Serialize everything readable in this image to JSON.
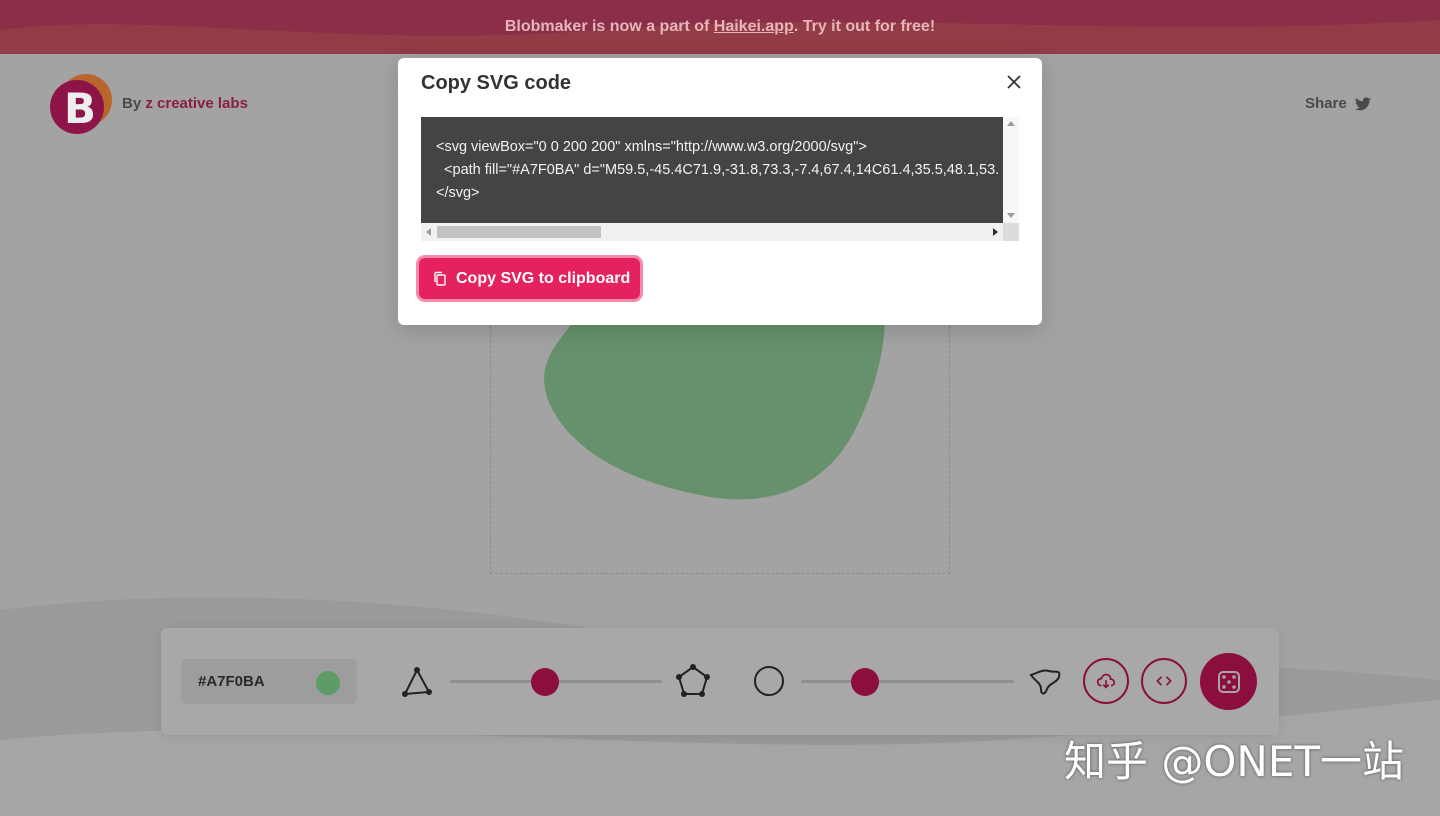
{
  "banner": {
    "text_before": "Blobmaker is now a part of ",
    "link": "Haikei.app",
    "text_after": ". Try it out for free!"
  },
  "header": {
    "logo_letter": "B",
    "by": "By ",
    "brand": "z creative labs",
    "share": "Share"
  },
  "toolbar": {
    "color_hex": "#A7F0BA",
    "complexity_level": 0.45,
    "contrast_level": 0.3
  },
  "modal": {
    "title": "Copy SVG code",
    "code": "<svg viewBox=\"0 0 200 200\" xmlns=\"http://www.w3.org/2000/svg\">\n  <path fill=\"#A7F0BA\" d=\"M59.5,-45.4C71.9,-31.8,73.3,-7.4,67.4,14C61.4,35.5,48.1,53.\n</svg>",
    "copy_button": "Copy SVG to clipboard"
  },
  "watermark": "知乎 @ONET一站",
  "colors": {
    "accent": "#e6215f",
    "brand_dark": "#8b0e3e",
    "blob": "#5e9b67"
  }
}
